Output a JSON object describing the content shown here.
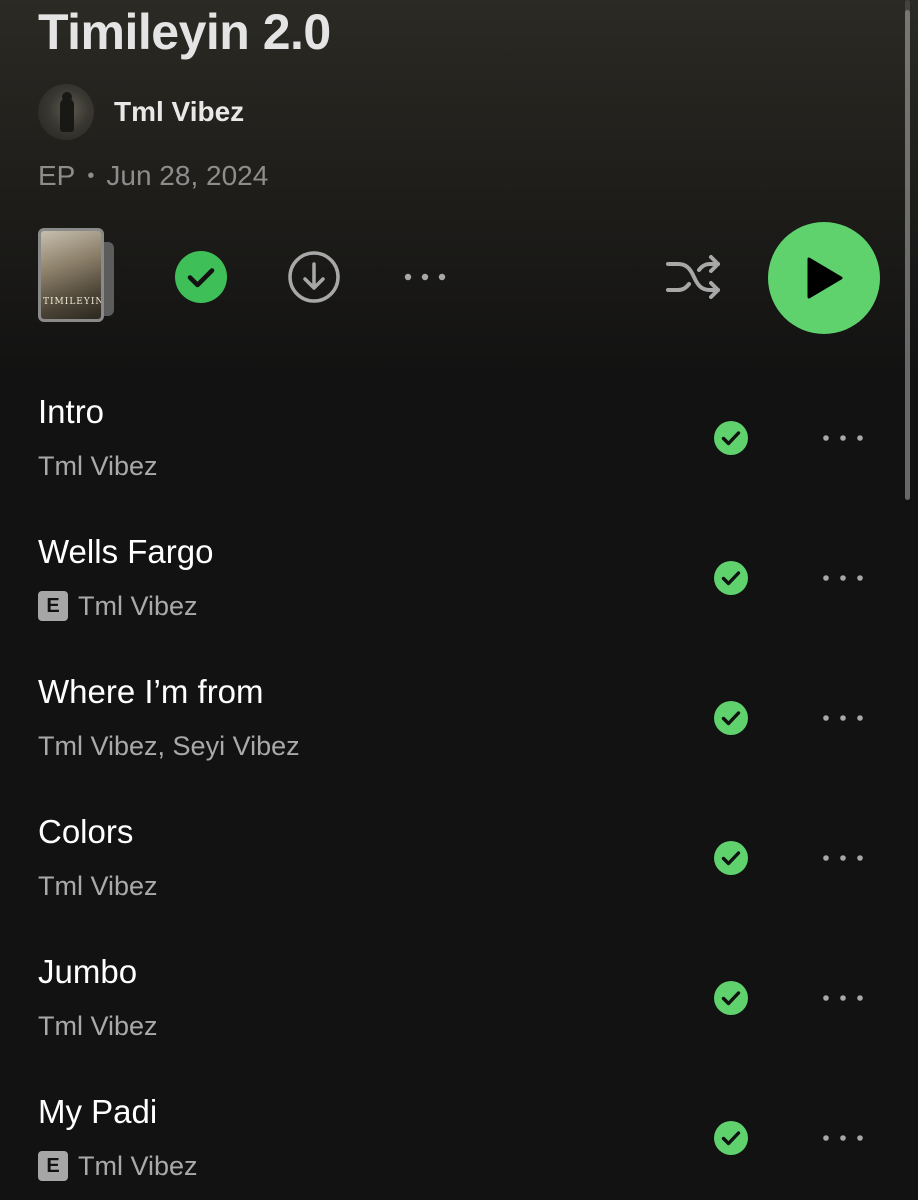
{
  "header": {
    "album_title": "Timileyin 2.0",
    "artist_name": "Tml Vibez",
    "release_type": "EP",
    "separator": "•",
    "release_date": "Jun 28, 2024",
    "cover_text": "TIMILEYIN"
  },
  "controls": {
    "saved_icon": "check-circle-filled-icon",
    "download_icon": "download-circle-icon",
    "more_icon": "more-horizontal-icon",
    "shuffle_icon": "shuffle-icon",
    "play_icon": "play-icon"
  },
  "colors": {
    "accent_green": "#5fd16d",
    "background": "#121212",
    "secondary_text": "#a9a9a9"
  },
  "tracks": [
    {
      "title": "Intro",
      "artists": "Tml Vibez",
      "explicit": false,
      "explicit_label": ""
    },
    {
      "title": "Wells Fargo",
      "artists": "Tml Vibez",
      "explicit": true,
      "explicit_label": "E"
    },
    {
      "title": "Where I’m from",
      "artists": "Tml Vibez, Seyi Vibez",
      "explicit": false,
      "explicit_label": ""
    },
    {
      "title": "Colors",
      "artists": "Tml Vibez",
      "explicit": false,
      "explicit_label": ""
    },
    {
      "title": "Jumbo",
      "artists": "Tml Vibez",
      "explicit": false,
      "explicit_label": ""
    },
    {
      "title": "My Padi",
      "artists": "Tml Vibez",
      "explicit": true,
      "explicit_label": "E"
    }
  ]
}
